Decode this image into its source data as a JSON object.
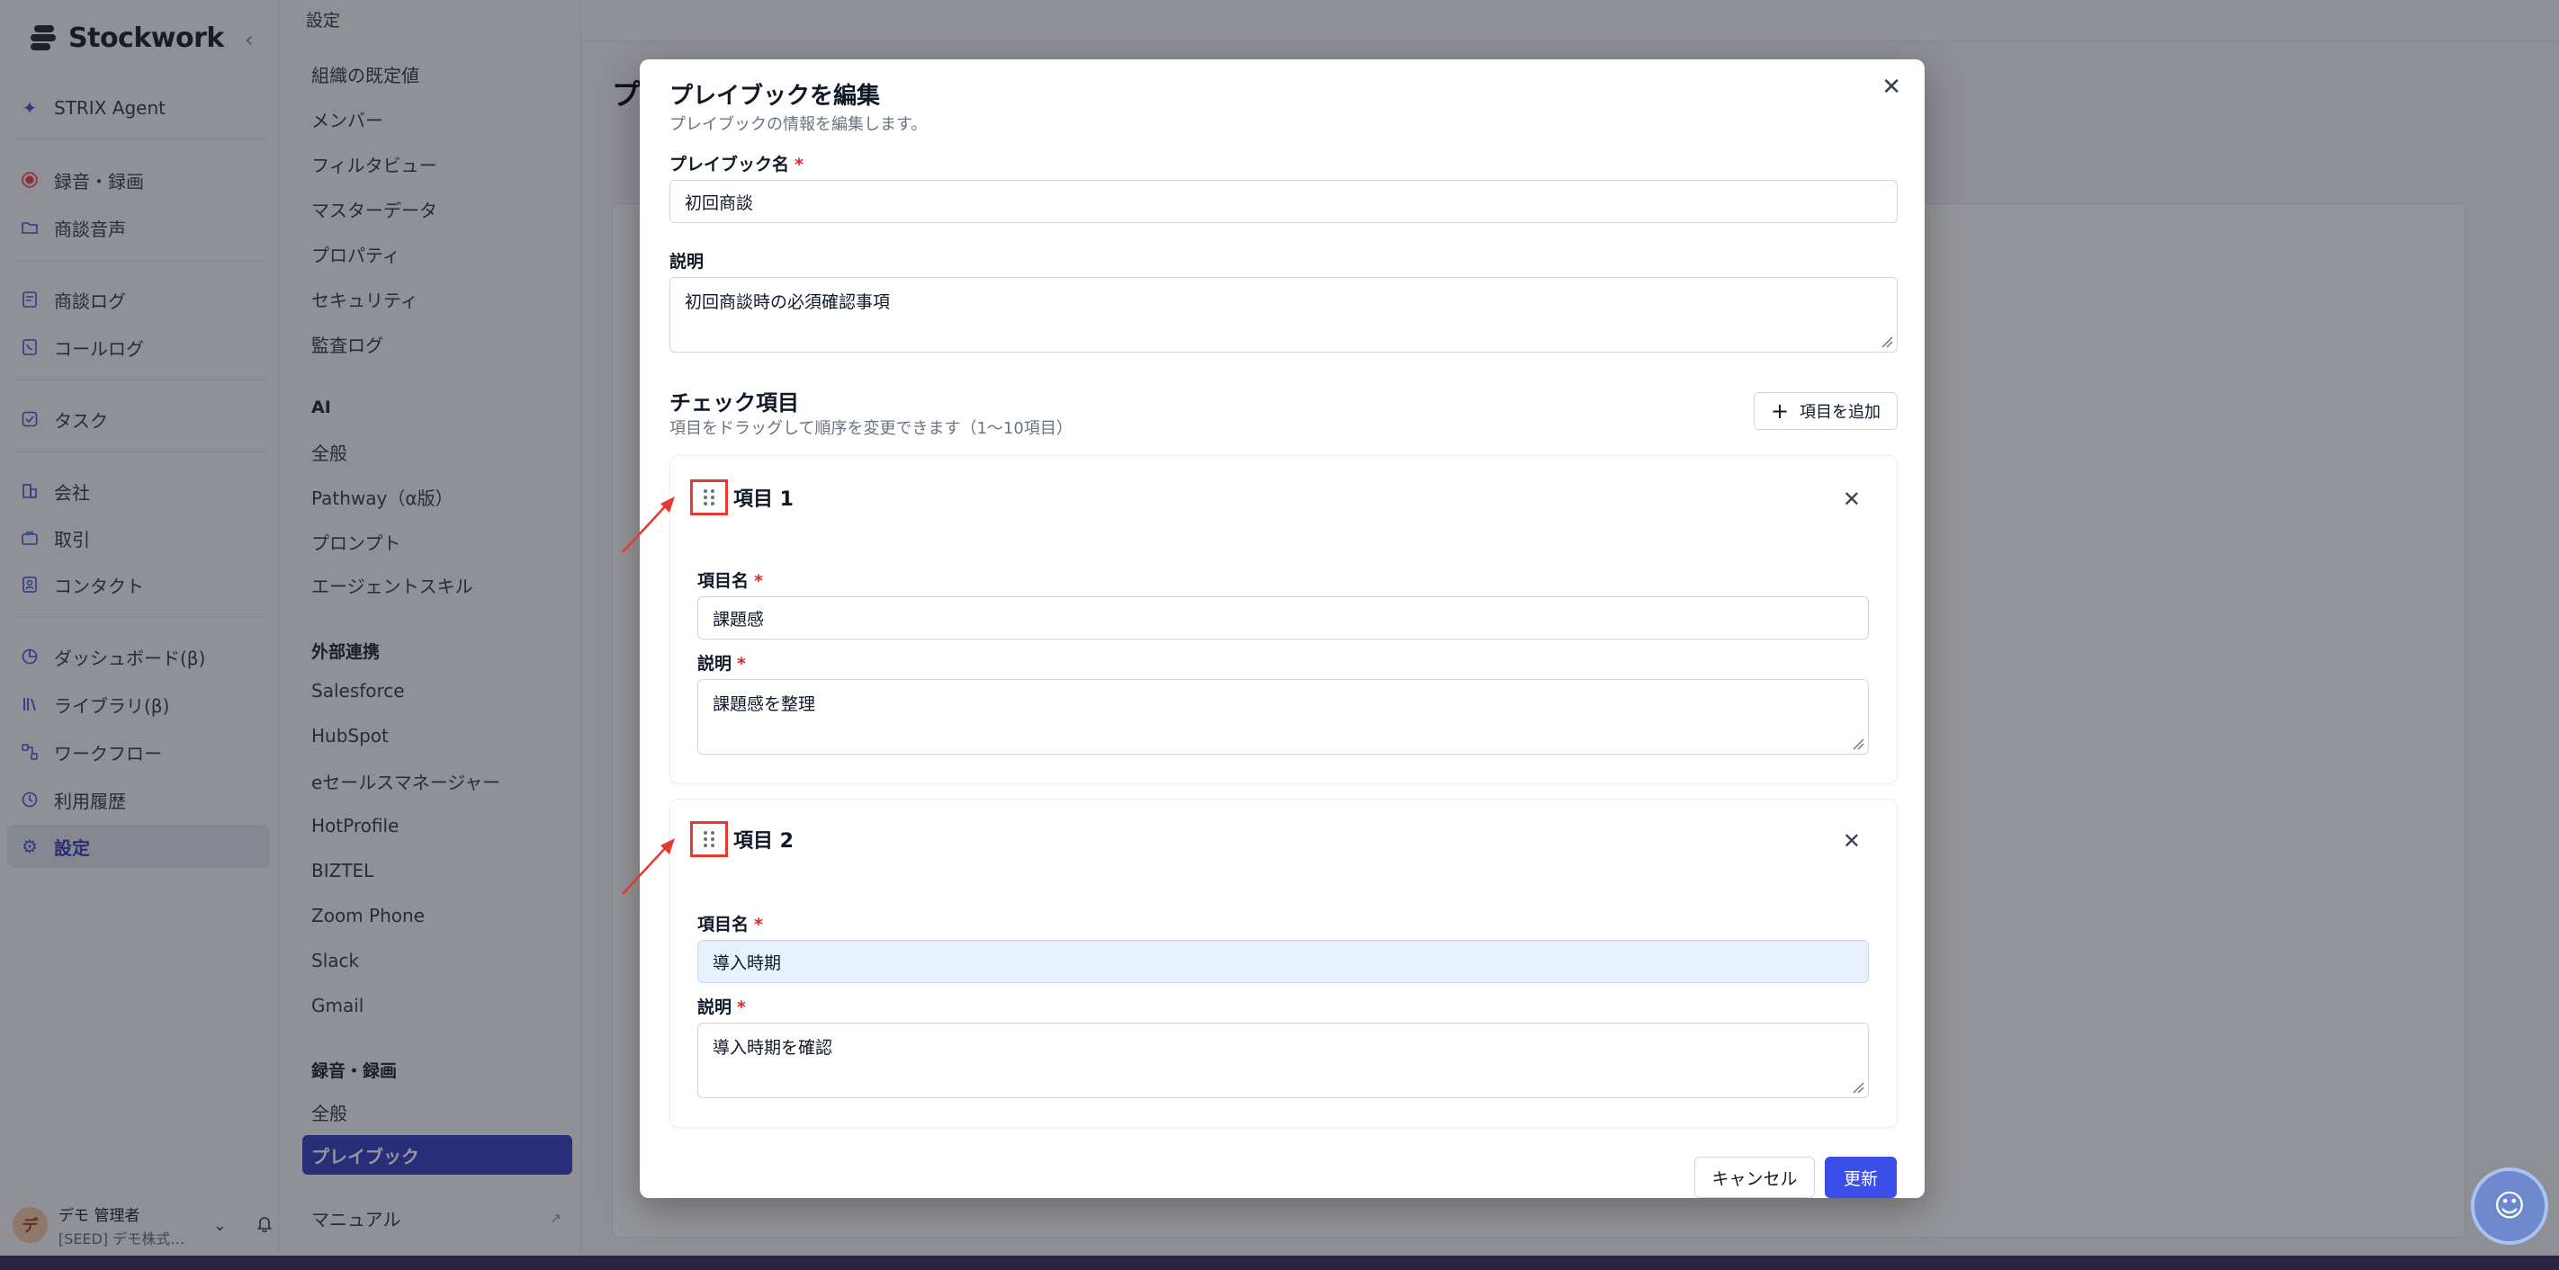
{
  "app": {
    "name": "Stockwork"
  },
  "sidebar": {
    "items": [
      {
        "label": "STRIX Agent",
        "icon": "sparkle-icon"
      },
      {
        "label": "録音・録画",
        "icon": "record-icon"
      },
      {
        "label": "商談音声",
        "icon": "folder-icon"
      },
      {
        "label": "商談ログ",
        "icon": "document-icon"
      },
      {
        "label": "コールログ",
        "icon": "phone-icon"
      },
      {
        "label": "タスク",
        "icon": "checkbox-icon"
      },
      {
        "label": "会社",
        "icon": "building-icon"
      },
      {
        "label": "取引",
        "icon": "briefcase-icon"
      },
      {
        "label": "コンタクト",
        "icon": "contact-icon"
      },
      {
        "label": "ダッシュボード(β)",
        "icon": "chart-icon"
      },
      {
        "label": "ライブラリ(β)",
        "icon": "library-icon"
      },
      {
        "label": "ワークフロー",
        "icon": "workflow-icon"
      },
      {
        "label": "利用履歴",
        "icon": "history-icon"
      },
      {
        "label": "設定",
        "icon": "gear-icon"
      }
    ],
    "user": {
      "initial": "デ",
      "name": "デモ 管理者",
      "org": "[SEED] デモ株式…"
    }
  },
  "settings_nav": {
    "header": "設定",
    "org_items": [
      "組織の既定値",
      "メンバー",
      "フィルタビュー",
      "マスターデータ",
      "プロパティ",
      "セキュリティ",
      "監査ログ"
    ],
    "ai_group": "AI",
    "ai_items": [
      "全般",
      "Pathway（α版）",
      "プロンプト",
      "エージェントスキル"
    ],
    "ext_group": "外部連携",
    "ext_items": [
      "Salesforce",
      "HubSpot",
      "eセールスマネージャー",
      "HotProfile",
      "BIZTEL",
      "Zoom Phone",
      "Slack",
      "Gmail"
    ],
    "rec_group": "録音・録画",
    "rec_items": [
      "全般",
      "プレイブック"
    ],
    "manual": "マニュアル"
  },
  "main": {
    "title_partial": "プ"
  },
  "modal": {
    "title": "プレイブックを編集",
    "subtitle": "プレイブックの情報を編集します。",
    "name_label": "プレイブック名",
    "name_value": "初回商談",
    "desc_label": "説明",
    "desc_value": "初回商談時の必須確認事項",
    "section_title": "チェック項目",
    "section_sub": "項目をドラッグして順序を変更できます（1〜10項目）",
    "add_item_label": "項目を追加",
    "required_mark": "*",
    "items": [
      {
        "title": "項目 1",
        "name_label": "項目名",
        "name_value": "課題感",
        "desc_label": "説明",
        "desc_value": "課題感を整理"
      },
      {
        "title": "項目 2",
        "name_label": "項目名",
        "name_value": "導入時期",
        "desc_label": "説明",
        "desc_value": "導入時期を確認"
      }
    ],
    "cancel_label": "キャンセル",
    "submit_label": "更新"
  },
  "colors": {
    "accent": "#3b4ee8",
    "nav_active": "#3c44c4",
    "annotation": "#e53a2f",
    "required": "#dc2626"
  }
}
